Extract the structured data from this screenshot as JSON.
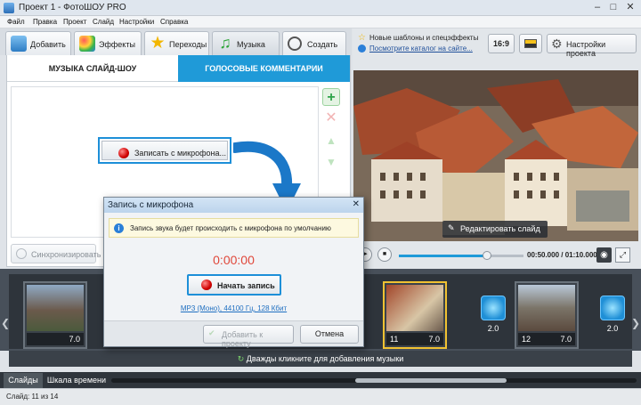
{
  "window": {
    "title": "Проект 1 - ФотоШОУ PRO"
  },
  "menu": [
    "Файл",
    "Правка",
    "Проект",
    "Слайд",
    "Настройки",
    "Справка"
  ],
  "tabs": [
    {
      "label": "Добавить",
      "icon": "add-photos-icon"
    },
    {
      "label": "Эффекты",
      "icon": "palette-icon"
    },
    {
      "label": "Переходы",
      "icon": "star-icon"
    },
    {
      "label": "Музыка",
      "icon": "music-note-icon"
    },
    {
      "label": "Создать",
      "icon": "film-reel-icon"
    }
  ],
  "subtabs": {
    "music": "МУЗЫКА СЛАЙД-ШОУ",
    "voice": "ГОЛОСОВЫЕ КОММЕНТАРИИ"
  },
  "record_button": "Записать с микрофона...",
  "sync_button": "Синхронизировать",
  "news": {
    "line1": "Новые шаблоны и спецэффекты",
    "line2": "Посмотрите каталог на сайте..."
  },
  "aspect_button": "16:9",
  "project_settings": "Настройки проекта",
  "edit_slide": "Редактировать слайд",
  "player": {
    "time": "00:50.000 / 01:10.000",
    "progress": 0.71
  },
  "slides": [
    {
      "num": "",
      "duration": "7.0"
    },
    {
      "num": "11",
      "duration": "7.0"
    },
    {
      "num": "12",
      "duration": "7.0"
    }
  ],
  "transitions": [
    "2.0",
    "2.0"
  ],
  "music_hint": "Дважды кликните для добавления музыки",
  "bottom_tabs": {
    "slides": "Слайды",
    "timeline": "Шкала времени"
  },
  "status": "Слайд: 11 из 14",
  "dialog": {
    "title": "Запись с микрофона",
    "info": "Запись звука будет происходить с микрофона по умолчанию",
    "timer": "0:00:00",
    "start": "Начать запись",
    "format": "MP3 (Моно), 44100 Гц, 128 Кбит",
    "add": "Добавить к проекту",
    "cancel": "Отмена"
  },
  "colors": {
    "accent": "#1f9ad8",
    "timer": "#e0473a"
  }
}
